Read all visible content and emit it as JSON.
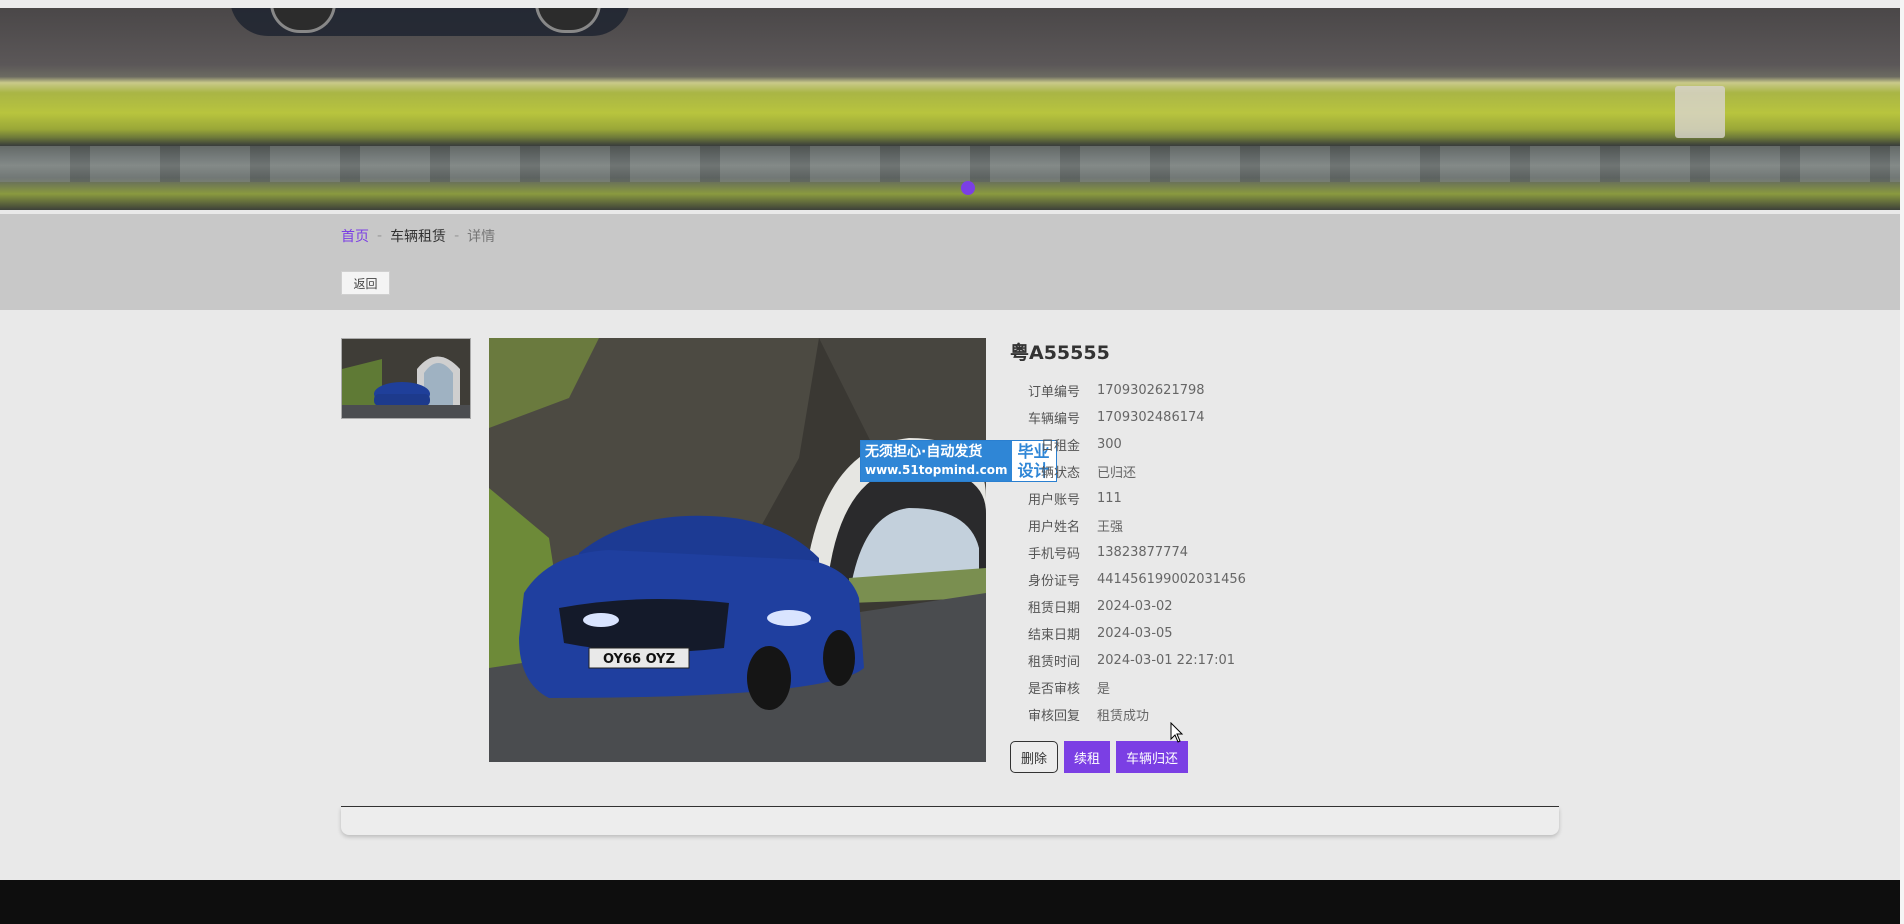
{
  "breadcrumb": {
    "home": "首页",
    "sep": "-",
    "category": "车辆租赁",
    "current": "详情"
  },
  "back_label": "返回",
  "plate": "粤A55555",
  "watermark": {
    "left_line1": "无须担心·自动发货",
    "left_line2": "www.51topmind.com",
    "right_line1": "毕业",
    "right_line2": "设计"
  },
  "license_plate_text": "OY66 OYZ",
  "fields": [
    {
      "label": "订单编号",
      "value": "1709302621798"
    },
    {
      "label": "车辆编号",
      "value": "1709302486174"
    },
    {
      "label": "日租金",
      "value": "300"
    },
    {
      "label": "辆状态",
      "value": "已归还"
    },
    {
      "label": "用户账号",
      "value": "111"
    },
    {
      "label": "用户姓名",
      "value": "王强"
    },
    {
      "label": "手机号码",
      "value": "13823877774"
    },
    {
      "label": "身份证号",
      "value": "441456199002031456"
    },
    {
      "label": "租赁日期",
      "value": "2024-03-02"
    },
    {
      "label": "结束日期",
      "value": "2024-03-05"
    },
    {
      "label": "租赁时间",
      "value": "2024-03-01 22:17:01"
    },
    {
      "label": "是否审核",
      "value": "是"
    },
    {
      "label": "审核回复",
      "value": "租赁成功"
    }
  ],
  "actions": {
    "delete": "删除",
    "renew": "续租",
    "return": "车辆归还"
  },
  "colors": {
    "accent": "#7b3fe4",
    "watermark_blue": "#2f86d6",
    "footer": "#0e0e0e"
  }
}
